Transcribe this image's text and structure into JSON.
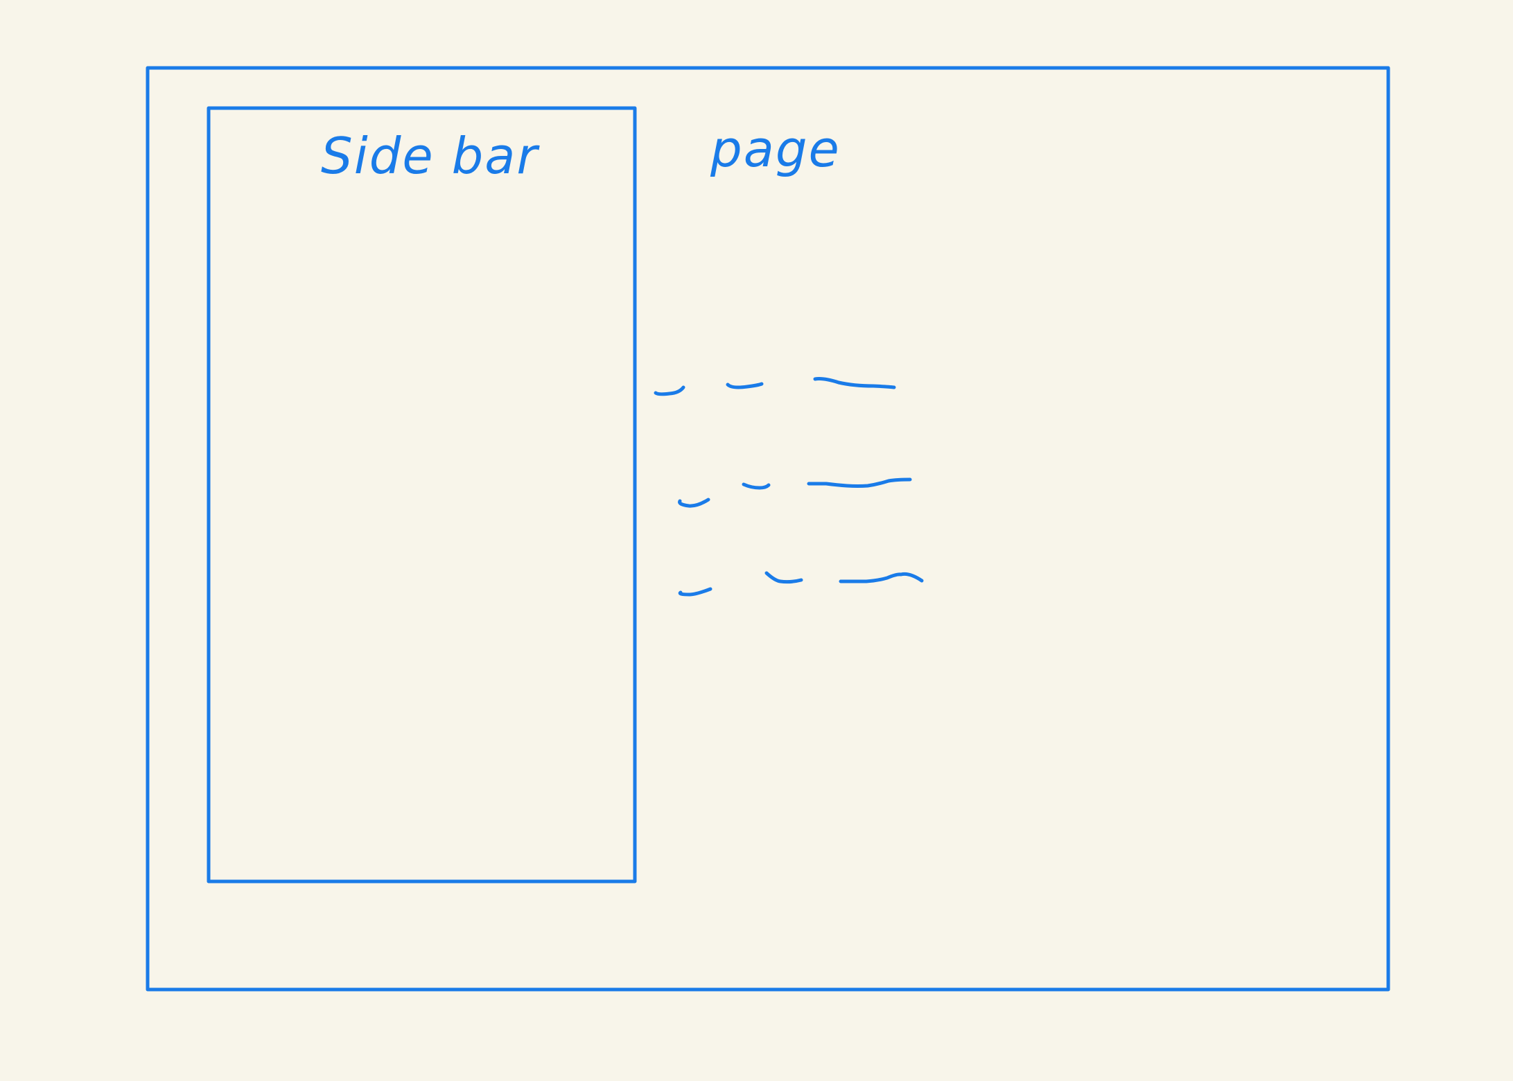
{
  "canvas": {
    "background_color": "#f8f5ea",
    "stroke_color": "#1a7be8"
  },
  "sidebar": {
    "label": "Side bar"
  },
  "page": {
    "label": "page",
    "placeholder_line_rows": 3,
    "placeholder_segments_per_row": 3
  }
}
